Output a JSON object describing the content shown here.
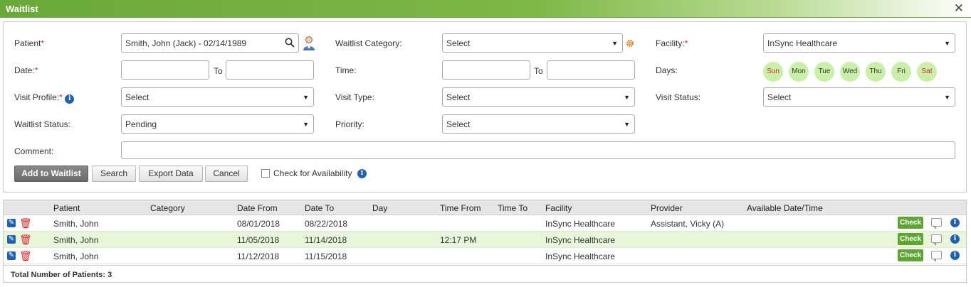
{
  "window": {
    "title": "Waitlist",
    "close_label": "✕"
  },
  "form": {
    "patient_label": "Patient",
    "patient_value": "Smith, John (Jack) - 02/14/1989",
    "waitlist_category_label": "Waitlist Category:",
    "waitlist_category_value": "Select",
    "facility_label": "Facility:",
    "facility_value": "InSync Healthcare",
    "date_label": "Date:",
    "date_from_value": "",
    "date_to_sep": "To",
    "date_to_value": "",
    "time_label": "Time:",
    "time_from_value": "",
    "time_to_sep": "To",
    "time_to_value": "",
    "days_label": "Days:",
    "days": [
      "Sun",
      "Mon",
      "Tue",
      "Wed",
      "Thu",
      "Fri",
      "Sat"
    ],
    "visit_profile_label": "Visit Profile:",
    "visit_profile_value": "Select",
    "visit_type_label": "Visit Type:",
    "visit_type_value": "Select",
    "visit_status_label": "Visit Status:",
    "visit_status_value": "Select",
    "waitlist_status_label": "Waitlist Status:",
    "waitlist_status_value": "Pending",
    "priority_label": "Priority:",
    "priority_value": "Select",
    "comment_label": "Comment:",
    "comment_value": ""
  },
  "actions": {
    "add_label": "Add to Waitlist",
    "search_label": "Search",
    "export_label": "Export Data",
    "cancel_label": "Cancel",
    "check_availability_label": "Check for Availability"
  },
  "grid": {
    "columns": [
      "Patient",
      "Category",
      "Date From",
      "Date To",
      "Day",
      "Time From",
      "Time To",
      "Facility",
      "Provider",
      "Available Date/Time"
    ],
    "rows": [
      {
        "patient": "Smith, John",
        "category": "",
        "date_from": "08/01/2018",
        "date_to": "08/22/2018",
        "day": "",
        "time_from": "",
        "time_to": "",
        "facility": "InSync Healthcare",
        "provider": "Assistant, Vicky (A)",
        "available": ""
      },
      {
        "patient": "Smith, John",
        "category": "",
        "date_from": "11/05/2018",
        "date_to": "11/14/2018",
        "day": "",
        "time_from": "12:17 PM",
        "time_to": "",
        "facility": "InSync Healthcare",
        "provider": "",
        "available": ""
      },
      {
        "patient": "Smith, John",
        "category": "",
        "date_from": "11/12/2018",
        "date_to": "11/15/2018",
        "day": "",
        "time_from": "",
        "time_to": "",
        "facility": "InSync Healthcare",
        "provider": "",
        "available": ""
      }
    ],
    "check_label": "Check",
    "total_label": "Total Number of Patients: 3"
  },
  "icons": {
    "search": "search-icon",
    "patient_card": "patient-card-icon",
    "settings": "gear-icon",
    "info": "info-icon",
    "edit": "edit-icon",
    "delete": "trash-icon",
    "comment": "comment-icon"
  },
  "colors": {
    "title_bar": "#7db846",
    "required": "#d9262c",
    "day_chip": "#c9f0a8",
    "check_button": "#5ea632",
    "alt_row": "#e9f6da",
    "info": "#1f62b4"
  }
}
